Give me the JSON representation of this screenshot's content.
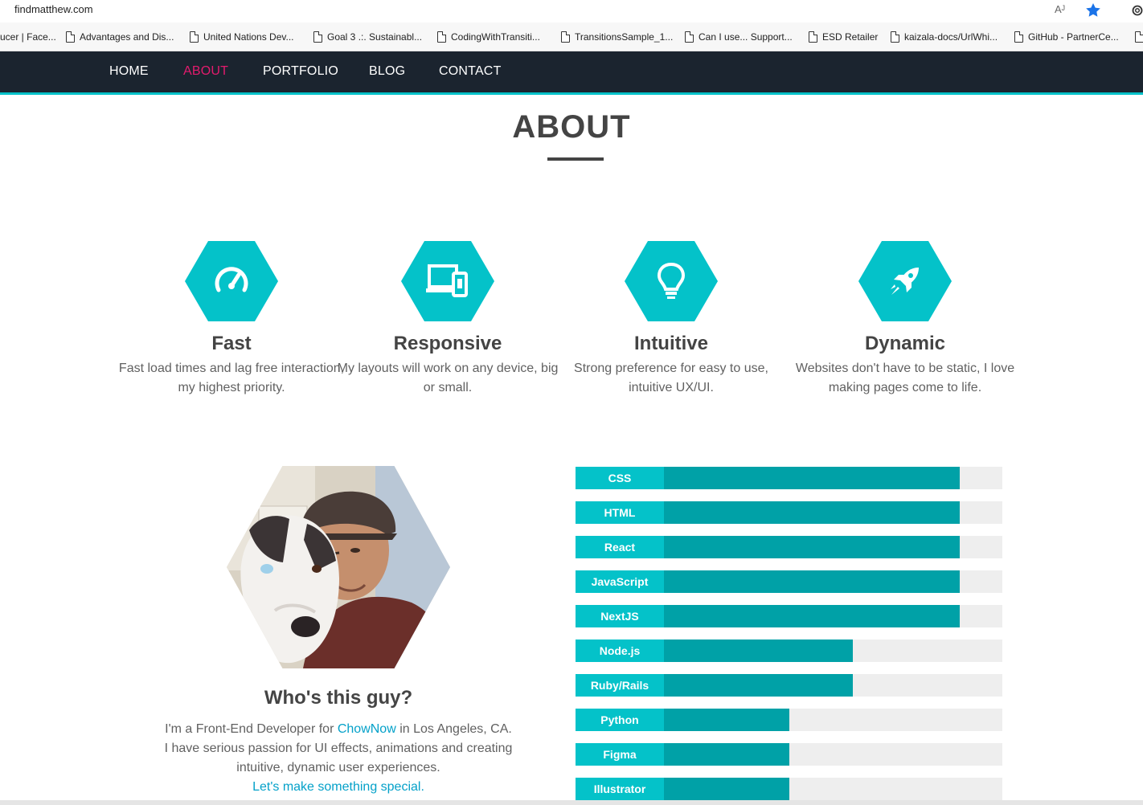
{
  "browser": {
    "url": "findmatthew.com",
    "read_aloud": "Aᴶ",
    "bookmarks": [
      {
        "label": "ucer | Face..."
      },
      {
        "label": "Advantages and Dis..."
      },
      {
        "label": "United Nations Dev..."
      },
      {
        "label": "Goal 3 .:. Sustainabl..."
      },
      {
        "label": "CodingWithTransiti..."
      },
      {
        "label": "TransitionsSample_1..."
      },
      {
        "label": "Can I use... Support..."
      },
      {
        "label": "ESD Retailer"
      },
      {
        "label": "kaizala-docs/UrlWhi..."
      },
      {
        "label": "GitHub - PartnerCe..."
      }
    ]
  },
  "nav": {
    "items": [
      {
        "label": "HOME"
      },
      {
        "label": "ABOUT"
      },
      {
        "label": "PORTFOLIO"
      },
      {
        "label": "BLOG"
      },
      {
        "label": "CONTACT"
      }
    ],
    "active": "ABOUT",
    "accent_color": "#e31b6d"
  },
  "page": {
    "title": "ABOUT"
  },
  "features": [
    {
      "icon": "speedometer-icon",
      "title": "Fast",
      "desc": "Fast load times and lag free interaction, my highest priority."
    },
    {
      "icon": "devices-icon",
      "title": "Responsive",
      "desc": "My layouts will work on any device, big or small."
    },
    {
      "icon": "lightbulb-icon",
      "title": "Intuitive",
      "desc": "Strong preference for easy to use, intuitive UX/UI."
    },
    {
      "icon": "rocket-icon",
      "title": "Dynamic",
      "desc": "Websites don't have to be static, I love making pages come to life."
    }
  ],
  "bio": {
    "title": "Who's this guy?",
    "line1_pre": "I'm a Front-End Developer for ",
    "company": "ChowNow",
    "line1_post": " in Los Angeles, CA.",
    "line2": "I have serious passion for UI effects, animations and creating intuitive, dynamic user experiences.",
    "cta": "Let's make something special."
  },
  "skills": [
    {
      "name": "CSS",
      "level": 0.9
    },
    {
      "name": "HTML",
      "level": 0.9
    },
    {
      "name": "React",
      "level": 0.9
    },
    {
      "name": "JavaScript",
      "level": 0.9
    },
    {
      "name": "NextJS",
      "level": 0.9
    },
    {
      "name": "Node.js",
      "level": 0.65
    },
    {
      "name": "Ruby/Rails",
      "level": 0.65
    },
    {
      "name": "Python",
      "level": 0.5
    },
    {
      "name": "Figma",
      "level": 0.5
    },
    {
      "name": "Illustrator",
      "level": 0.5
    }
  ],
  "colors": {
    "teal": "#04c2c9",
    "teal_dark": "#00a1a7",
    "nav_bg": "#1b242f",
    "track": "#eeeeee"
  }
}
